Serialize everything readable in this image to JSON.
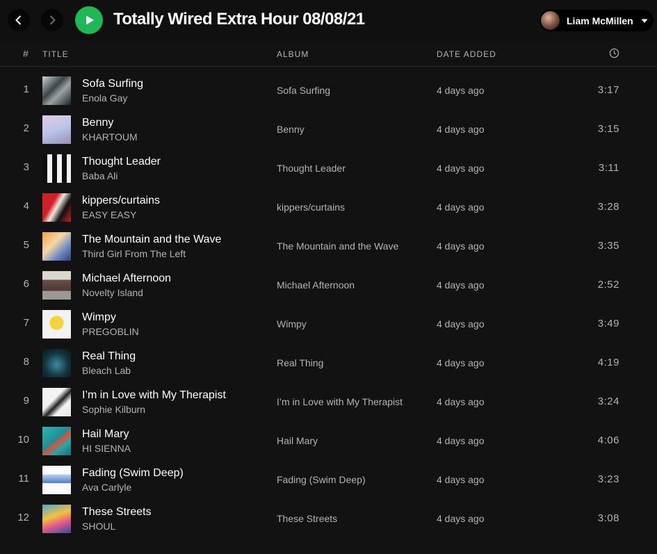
{
  "header": {
    "playlist_title": "Totally Wired Extra Hour 08/08/21",
    "user_name": "Liam McMillen",
    "icons": {
      "back": "chevron-left-icon",
      "forward": "chevron-right-icon",
      "play": "play-icon",
      "caret": "caret-down-icon",
      "duration": "clock-icon"
    }
  },
  "columns": {
    "number": "#",
    "title": "TITLE",
    "album": "ALBUM",
    "date_added": "DATE ADDED"
  },
  "colors": {
    "accent": "#1db954",
    "background": "#121212",
    "text_secondary": "#b3b3b3"
  },
  "tracks": [
    {
      "num": "1",
      "title": "Sofa Surfing",
      "artist": "Enola Gay",
      "album": "Sofa Surfing",
      "added": "4 days ago",
      "duration": "3:17"
    },
    {
      "num": "2",
      "title": "Benny",
      "artist": "KHARTOUM",
      "album": "Benny",
      "added": "4 days ago",
      "duration": "3:15"
    },
    {
      "num": "3",
      "title": "Thought Leader",
      "artist": "Baba Ali",
      "album": "Thought Leader",
      "added": "4 days ago",
      "duration": "3:11"
    },
    {
      "num": "4",
      "title": "kippers/curtains",
      "artist": "EASY EASY",
      "album": "kippers/curtains",
      "added": "4 days ago",
      "duration": "3:28"
    },
    {
      "num": "5",
      "title": "The Mountain and the Wave",
      "artist": "Third Girl From The Left",
      "album": "The Mountain and the Wave",
      "added": "4 days ago",
      "duration": "3:35"
    },
    {
      "num": "6",
      "title": "Michael Afternoon",
      "artist": "Novelty Island",
      "album": "Michael Afternoon",
      "added": "4 days ago",
      "duration": "2:52"
    },
    {
      "num": "7",
      "title": "Wimpy",
      "artist": "PREGOBLIN",
      "album": "Wimpy",
      "added": "4 days ago",
      "duration": "3:49"
    },
    {
      "num": "8",
      "title": "Real Thing",
      "artist": "Bleach Lab",
      "album": "Real Thing",
      "added": "4 days ago",
      "duration": "4:19"
    },
    {
      "num": "9",
      "title": "I’m in Love with My Therapist",
      "artist": "Sophie Kilburn",
      "album": "I’m in Love with My Therapist",
      "added": "4 days ago",
      "duration": "3:24"
    },
    {
      "num": "10",
      "title": "Hail Mary",
      "artist": "HI SIENNA",
      "album": "Hail Mary",
      "added": "4 days ago",
      "duration": "4:06"
    },
    {
      "num": "11",
      "title": "Fading (Swim Deep)",
      "artist": "Ava Carlyle",
      "album": "Fading (Swim Deep)",
      "added": "4 days ago",
      "duration": "3:23"
    },
    {
      "num": "12",
      "title": "These Streets",
      "artist": "SHOUL",
      "album": "These Streets",
      "added": "4 days ago",
      "duration": "3:08"
    }
  ]
}
